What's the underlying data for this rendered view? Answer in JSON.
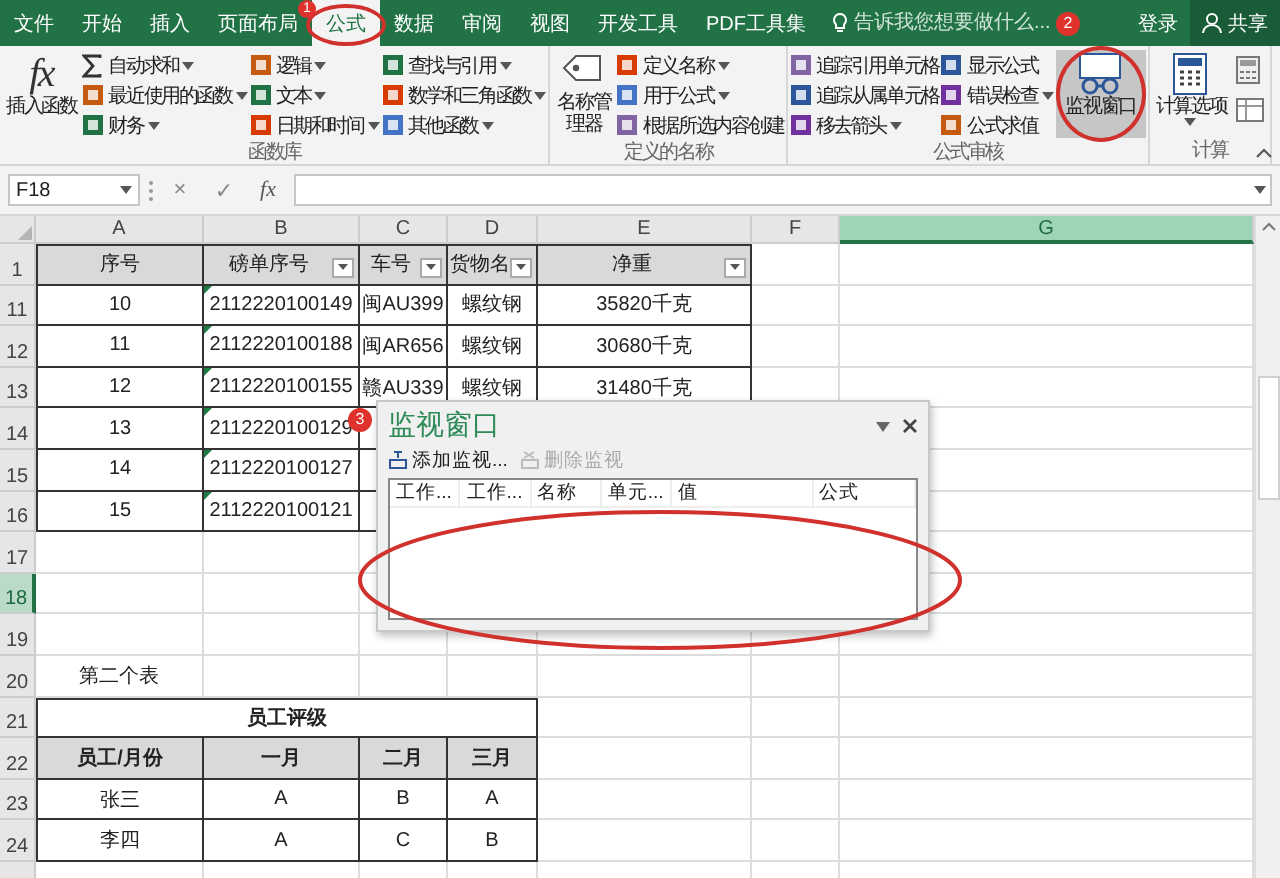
{
  "ribbon_tabs": [
    {
      "label": "文件",
      "selected": false
    },
    {
      "label": "开始",
      "selected": false
    },
    {
      "label": "插入",
      "selected": false
    },
    {
      "label": "页面布局",
      "selected": false
    },
    {
      "label": "公式",
      "selected": true
    },
    {
      "label": "数据",
      "selected": false
    },
    {
      "label": "审阅",
      "selected": false
    },
    {
      "label": "视图",
      "selected": false
    },
    {
      "label": "开发工具",
      "selected": false
    },
    {
      "label": "PDF工具集",
      "selected": false
    }
  ],
  "tell_me": {
    "placeholder": "告诉我您想要做什么..."
  },
  "account": {
    "sign_in": "登录",
    "share": "共享"
  },
  "ribbon": {
    "groups": [
      {
        "title": "函数库",
        "columns": [
          [
            {
              "kind": "large",
              "glyph": "fx",
              "label": "插入函数",
              "menu": false,
              "pressed": false
            }
          ],
          [
            {
              "kind": "small",
              "label": "自动求和",
              "menu": true
            },
            {
              "kind": "small",
              "label": "最近使用的函数",
              "menu": true
            },
            {
              "kind": "small",
              "label": "财务",
              "menu": true
            }
          ],
          [
            {
              "kind": "small",
              "label": "逻辑",
              "menu": true
            },
            {
              "kind": "small",
              "label": "文本",
              "menu": true
            },
            {
              "kind": "small",
              "label": "日期和时间",
              "menu": true
            }
          ],
          [
            {
              "kind": "small",
              "label": "查找与引用",
              "menu": true
            },
            {
              "kind": "small",
              "label": "数学和三角函数",
              "menu": true
            },
            {
              "kind": "small",
              "label": "其他函数",
              "menu": true
            }
          ]
        ]
      },
      {
        "title": "定义的名称",
        "columns": [
          [
            {
              "kind": "large",
              "label": "名称管理器",
              "menu": false,
              "pressed": false
            }
          ],
          [
            {
              "kind": "small",
              "label": "定义名称",
              "menu": true
            },
            {
              "kind": "small",
              "label": "用于公式",
              "menu": true
            },
            {
              "kind": "small",
              "label": "根据所选内容创建",
              "menu": false
            }
          ]
        ]
      },
      {
        "title": "公式审核",
        "columns": [
          [
            {
              "kind": "small",
              "label": "追踪引用单元格",
              "menu": false
            },
            {
              "kind": "small",
              "label": "追踪从属单元格",
              "menu": false
            },
            {
              "kind": "small",
              "label": "移去箭头",
              "menu": true
            }
          ],
          [
            {
              "kind": "small",
              "label": "显示公式",
              "menu": false
            },
            {
              "kind": "small",
              "label": "错误检查",
              "menu": true
            },
            {
              "kind": "small",
              "label": "公式求值",
              "menu": false
            }
          ],
          [
            {
              "kind": "large",
              "label": "监视窗口",
              "menu": false,
              "pressed": true
            }
          ]
        ]
      },
      {
        "title": "计算",
        "columns": [
          [
            {
              "kind": "large",
              "label": "计算选项",
              "menu": true,
              "pressed": false
            }
          ],
          [
            {
              "kind": "icon"
            },
            {
              "kind": "icon"
            }
          ]
        ]
      }
    ]
  },
  "formula_bar": {
    "name_box": "F18",
    "cancel": "×",
    "enter": "✓",
    "function": "fx"
  },
  "sheet": {
    "columns": [
      {
        "label": "A",
        "selected": false
      },
      {
        "label": "B",
        "selected": false
      },
      {
        "label": "C",
        "selected": false
      },
      {
        "label": "D",
        "selected": false
      },
      {
        "label": "E",
        "selected": false
      },
      {
        "label": "F",
        "selected": false
      },
      {
        "label": "G",
        "selected": true
      }
    ],
    "row_headers": [
      {
        "label": "1",
        "selected": false
      },
      {
        "label": "11",
        "selected": false
      },
      {
        "label": "12",
        "selected": false
      },
      {
        "label": "13",
        "selected": false
      },
      {
        "label": "14",
        "selected": false
      },
      {
        "label": "15",
        "selected": false
      },
      {
        "label": "16",
        "selected": false
      },
      {
        "label": "17",
        "selected": false
      },
      {
        "label": "18",
        "selected": true
      },
      {
        "label": "19",
        "selected": false
      },
      {
        "label": "20",
        "selected": false
      },
      {
        "label": "21",
        "selected": false
      },
      {
        "label": "22",
        "selected": false
      },
      {
        "label": "23",
        "selected": false
      },
      {
        "label": "24",
        "selected": false
      }
    ],
    "table_1": {
      "header": [
        {
          "text": "序号",
          "filter": false
        },
        {
          "text": "磅单序号",
          "filter": true
        },
        {
          "text": "车号",
          "filter": true
        },
        {
          "text": "货物名",
          "filter": true
        },
        {
          "text": "净重",
          "filter": true
        }
      ],
      "rows": [
        {
          "cells": [
            "10",
            "2112220100149",
            "闽AU399",
            "螺纹钢",
            "35820千克"
          ],
          "number_as_text_flag": true
        },
        {
          "cells": [
            "11",
            "2112220100188",
            "闽AR656",
            "螺纹钢",
            "30680千克"
          ],
          "number_as_text_flag": true
        },
        {
          "cells": [
            "12",
            "2112220100155",
            "赣AU339",
            "螺纹钢",
            "31480千克"
          ],
          "number_as_text_flag": true
        },
        {
          "cells": [
            "13",
            "2112220100129"
          ],
          "number_as_text_flag": true
        },
        {
          "cells": [
            "14",
            "2112220100127"
          ],
          "number_as_text_flag": true
        },
        {
          "cells": [
            "15",
            "2112220100121"
          ],
          "number_as_text_flag": true
        }
      ]
    },
    "table_2": {
      "caption": "第二个表",
      "title": "员工评级",
      "header": [
        "员工/月份",
        "一月",
        "二月",
        "三月"
      ],
      "rows": [
        [
          "张三",
          "A",
          "B",
          "A"
        ],
        [
          "李四",
          "A",
          "C",
          "B"
        ]
      ]
    }
  },
  "watch_window": {
    "title": "监视窗口",
    "toolbar": [
      {
        "label": "添加监视...",
        "disabled": false
      },
      {
        "label": "删除监视",
        "disabled": true
      }
    ],
    "columns": [
      "工作...",
      "工作...",
      "名称",
      "单元...",
      "值",
      "公式"
    ]
  },
  "annotations": [
    {
      "number": "1"
    },
    {
      "number": "2"
    },
    {
      "number": "3"
    }
  ]
}
